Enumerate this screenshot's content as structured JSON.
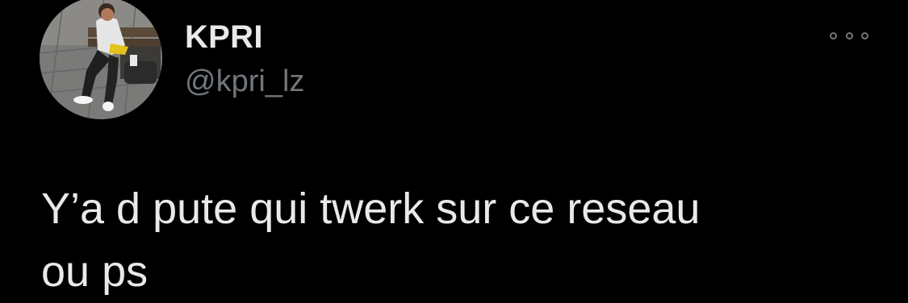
{
  "tweet": {
    "author": {
      "display_name": "KPRI",
      "handle": "@kpri_lz"
    },
    "text": "Y’a d pute qui twerk sur ce reseau\nou ps",
    "more_icon": "more-horizontal-icon"
  },
  "colors": {
    "background": "#000000",
    "primary_text": "#e7e9ea",
    "secondary_text": "#71767b"
  }
}
